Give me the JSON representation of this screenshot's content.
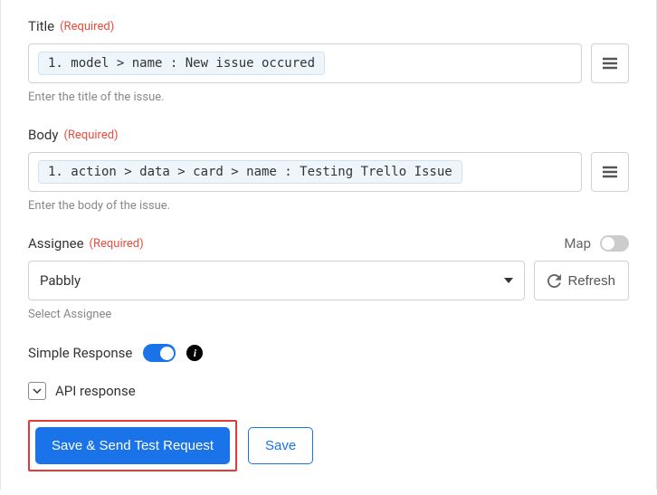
{
  "title_field": {
    "label": "Title",
    "required_tag": "(Required)",
    "token_value": "1. model > name : New issue occured",
    "hint": "Enter the title of the issue."
  },
  "body_field": {
    "label": "Body",
    "required_tag": "(Required)",
    "token_value": "1. action > data > card > name : Testing Trello Issue",
    "hint": "Enter the body of the issue."
  },
  "assignee_field": {
    "label": "Assignee",
    "required_tag": "(Required)",
    "map_label": "Map",
    "selected": "Pabbly",
    "refresh_label": "Refresh",
    "hint": "Select Assignee"
  },
  "simple_response": {
    "label": "Simple Response"
  },
  "api_response": {
    "label": "API response"
  },
  "buttons": {
    "primary": "Save & Send Test Request",
    "secondary": "Save"
  }
}
